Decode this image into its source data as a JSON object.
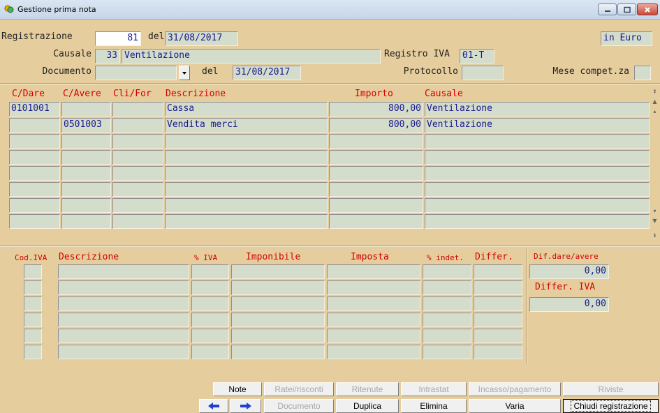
{
  "window": {
    "title": "Gestione prima nota"
  },
  "header": {
    "registrazione_label": "Registrazione",
    "registrazione_value": "81",
    "del_label_1": "del",
    "data_registrazione": "31/08/2017",
    "currency_badge": "in Euro",
    "causale_label": "Causale",
    "causale_code": "33",
    "causale_desc": "Ventilazione",
    "registro_iva_label": "Registro IVA",
    "registro_iva_value": "01-T",
    "documento_label": "Documento",
    "documento_value": "",
    "del_label_2": "del",
    "data_documento": "31/08/2017",
    "protocollo_label": "Protocollo",
    "protocollo_value": "",
    "mese_label": "Mese compet.za",
    "mese_value": ""
  },
  "entries": {
    "columns": [
      "C/Dare",
      "C/Avere",
      "Cli/For",
      "Descrizione",
      "Importo",
      "Causale"
    ],
    "rows": [
      {
        "dare": "0101001",
        "avere": "",
        "clifor": "",
        "descr": "Cassa",
        "importo": "800,00",
        "causale": "Ventilazione"
      },
      {
        "dare": "",
        "avere": "0501003",
        "clifor": "",
        "descr": "Vendita merci",
        "importo": "800,00",
        "causale": "Ventilazione"
      },
      {
        "dare": "",
        "avere": "",
        "clifor": "",
        "descr": "",
        "importo": "",
        "causale": ""
      },
      {
        "dare": "",
        "avere": "",
        "clifor": "",
        "descr": "",
        "importo": "",
        "causale": ""
      },
      {
        "dare": "",
        "avere": "",
        "clifor": "",
        "descr": "",
        "importo": "",
        "causale": ""
      },
      {
        "dare": "",
        "avere": "",
        "clifor": "",
        "descr": "",
        "importo": "",
        "causale": ""
      },
      {
        "dare": "",
        "avere": "",
        "clifor": "",
        "descr": "",
        "importo": "",
        "causale": ""
      },
      {
        "dare": "",
        "avere": "",
        "clifor": "",
        "descr": "",
        "importo": "",
        "causale": ""
      }
    ]
  },
  "iva": {
    "columns": [
      "Cod.IVA",
      "Descrizione",
      "% IVA",
      "Imponibile",
      "Imposta",
      "% indet.",
      "Differ."
    ],
    "rows": 6,
    "dif_dare_avere_label": "Dif.dare/avere",
    "dif_dare_avere_value": "0,00",
    "differ_iva_label": "Differ. IVA",
    "differ_iva_value": "0,00"
  },
  "buttons": {
    "row1": [
      {
        "label": "Note",
        "enabled": true
      },
      {
        "label": "Ratei/risconti",
        "enabled": false
      },
      {
        "label": "Ritenute",
        "enabled": false
      },
      {
        "label": "Intrastat",
        "enabled": false
      },
      {
        "label": "Incasso/pagamento",
        "enabled": false
      },
      {
        "label": "Riviste",
        "enabled": false
      }
    ],
    "row2": [
      {
        "label": "Documento",
        "enabled": false
      },
      {
        "label": "Duplica",
        "enabled": true
      },
      {
        "label": "Elimina",
        "enabled": true
      },
      {
        "label": "Varia",
        "enabled": true
      },
      {
        "label": "Chiudi registrazione",
        "enabled": true
      }
    ]
  }
}
